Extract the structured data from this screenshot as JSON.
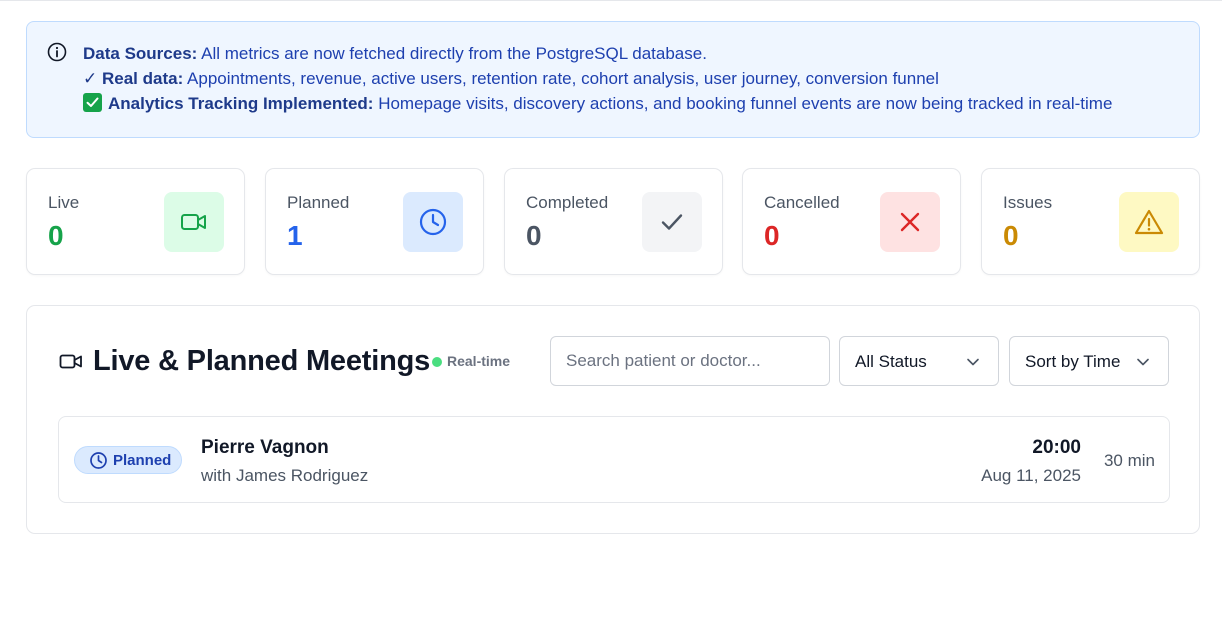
{
  "banner": {
    "line1_label": "Data Sources:",
    "line1_text": " All metrics are now fetched directly from the PostgreSQL database.",
    "line2_mark": "✓",
    "line2_label": "Real data:",
    "line2_text": " Appointments, revenue, active users, retention rate, cohort analysis, user journey, conversion funnel",
    "line3_label": "Analytics Tracking Implemented:",
    "line3_text": " Homepage visits, discovery actions, and booking funnel events are now being tracked in real-time"
  },
  "stats": [
    {
      "label": "Live",
      "value": "0",
      "color": "#16a34a",
      "icon": "video-icon",
      "icon_bg": "#dcfce7"
    },
    {
      "label": "Planned",
      "value": "1",
      "color": "#2563eb",
      "icon": "clock-icon",
      "icon_bg": "#dbeafe"
    },
    {
      "label": "Completed",
      "value": "0",
      "color": "#4b5563",
      "icon": "check-icon",
      "icon_bg": "#f3f4f6"
    },
    {
      "label": "Cancelled",
      "value": "0",
      "color": "#dc2626",
      "icon": "x-icon",
      "icon_bg": "#fee2e2"
    },
    {
      "label": "Issues",
      "value": "0",
      "color": "#ca8a04",
      "icon": "warning-icon",
      "icon_bg": "#fef9c3"
    }
  ],
  "meetings": {
    "title": "Live & Planned Meetings",
    "realtime_label": "Real-time",
    "search_placeholder": "Search patient or doctor...",
    "status_filter": "All Status",
    "sort": "Sort by Time",
    "items": [
      {
        "status": "Planned",
        "patient": "Pierre Vagnon",
        "doctor": "with James Rodriguez",
        "time": "20:00",
        "date": "Aug 11, 2025",
        "duration": "30 min"
      }
    ]
  }
}
